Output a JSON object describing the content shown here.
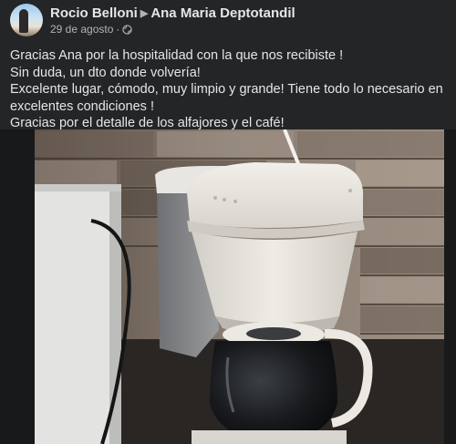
{
  "post": {
    "author": "Rocio Belloni",
    "recipient": "Ana Maria Deptotandil",
    "date": "29 de agosto",
    "separator": "·",
    "privacy_icon": "globe-icon",
    "body_lines": [
      "Gracias Ana por la hospitalidad con la que nos recibiste !",
      "Sin duda, un dto donde volvería!",
      "Excelente lugar, cómodo, muy limpio y grande! Tiene todo lo necesario en excelentes condiciones !",
      "Gracias por el detalle de los alfajores y el café!"
    ],
    "photo_subject": "coffee-maker-photo"
  },
  "colors": {
    "background": "#242526",
    "text": "#e4e6eb",
    "secondary_text": "#b0b3b8"
  }
}
